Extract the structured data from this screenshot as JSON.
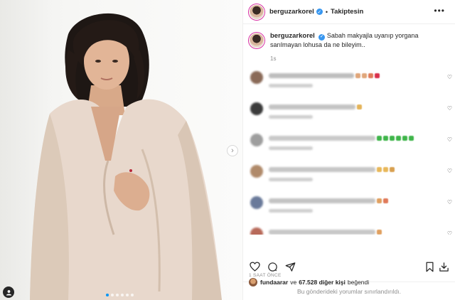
{
  "post": {
    "username": "berguzarkorel",
    "follow_label": "Takiptesin",
    "separator": "•",
    "more_label": "•••",
    "caption_text": "Sabah makyajla uyanıp yorgana sarılmayan lohusa da ne bileyim..",
    "caption_time": "1s",
    "liked_by_user": "fundaarar",
    "likes_connector": "ve",
    "likes_count_text": "67.528 diğer kişi",
    "likes_suffix": "beğendi",
    "post_time": "1 SAAT ÖNCE",
    "comments_restricted": "Bu gönderideki yorumlar sınırlandırıldı."
  },
  "photo": {
    "carousel_dots": 6,
    "active_dot": 0
  },
  "comments": [
    {
      "avatar_color": "#8a6a58",
      "line_color": "#bdbdbd",
      "emoji_colors": [
        "#e0a67a",
        "#e0a67a",
        "#e07a5a",
        "#d9304c"
      ]
    },
    {
      "avatar_color": "#3b3b3b",
      "line_color": "#c4c4c4",
      "emoji_colors": [
        "#e4b45a"
      ]
    },
    {
      "avatar_color": "#9e9e9e",
      "line_color": "#c9c9c9",
      "emoji_colors": [
        "#3fb54a",
        "#3fb54a",
        "#3fb54a",
        "#3fb54a",
        "#3fb54a",
        "#3fb54a"
      ]
    },
    {
      "avatar_color": "#b08a6a",
      "line_color": "#c6c6c6",
      "emoji_colors": [
        "#e8b85a",
        "#e8b85a",
        "#d8a050"
      ]
    },
    {
      "avatar_color": "#6a7a9a",
      "line_color": "#c3c3c3",
      "emoji_colors": [
        "#e0a060",
        "#e07a5a"
      ]
    },
    {
      "avatar_color": "#b86a5a",
      "line_color": "#c8c8c8",
      "emoji_colors": [
        "#e0a060"
      ]
    }
  ],
  "icons": {
    "verified": "verified-badge-icon",
    "like": "heart-icon",
    "comment": "comment-bubble-icon",
    "share": "paper-plane-icon",
    "save": "bookmark-icon",
    "download": "download-icon",
    "next": "chevron-right-icon",
    "tag": "user-tag-icon"
  },
  "colors": {
    "accent": "#0095f6",
    "verified": "#3897f0",
    "muted": "#8e8e8e",
    "text": "#262626"
  }
}
